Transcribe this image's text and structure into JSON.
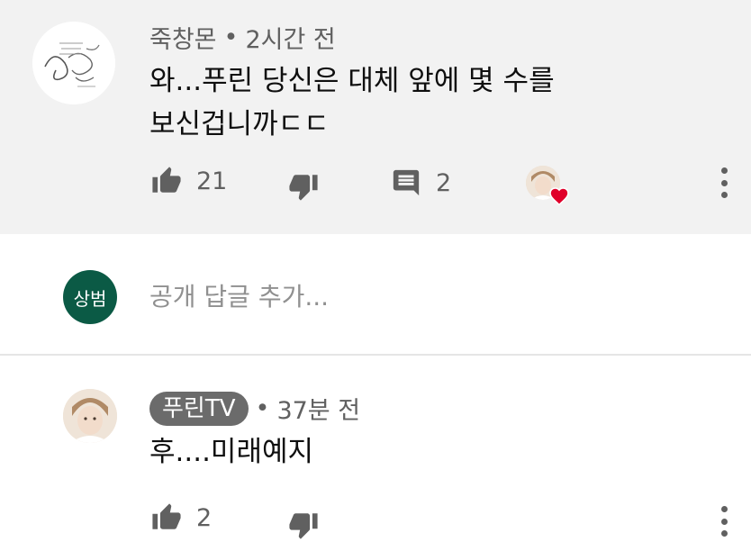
{
  "comment": {
    "author": "죽창몬",
    "time": "2시간 전",
    "text_line1": "와...푸린 당신은 대체 앞에 몇 수를",
    "text_line2": "보신겁니까ㄷㄷ",
    "likes": "21",
    "replies": "2"
  },
  "reply_box": {
    "avatar_text": "상범",
    "placeholder": "공개 답글 추가..."
  },
  "reply": {
    "author": "푸린TV",
    "time": "37분 전",
    "text": "후....미래예지",
    "likes": "2"
  },
  "separator": "•",
  "colors": {
    "bg_highlight": "#f2f2f2",
    "self_avatar": "#0b5a45",
    "heart": "#e0002a",
    "chip": "#6b6b6b"
  }
}
